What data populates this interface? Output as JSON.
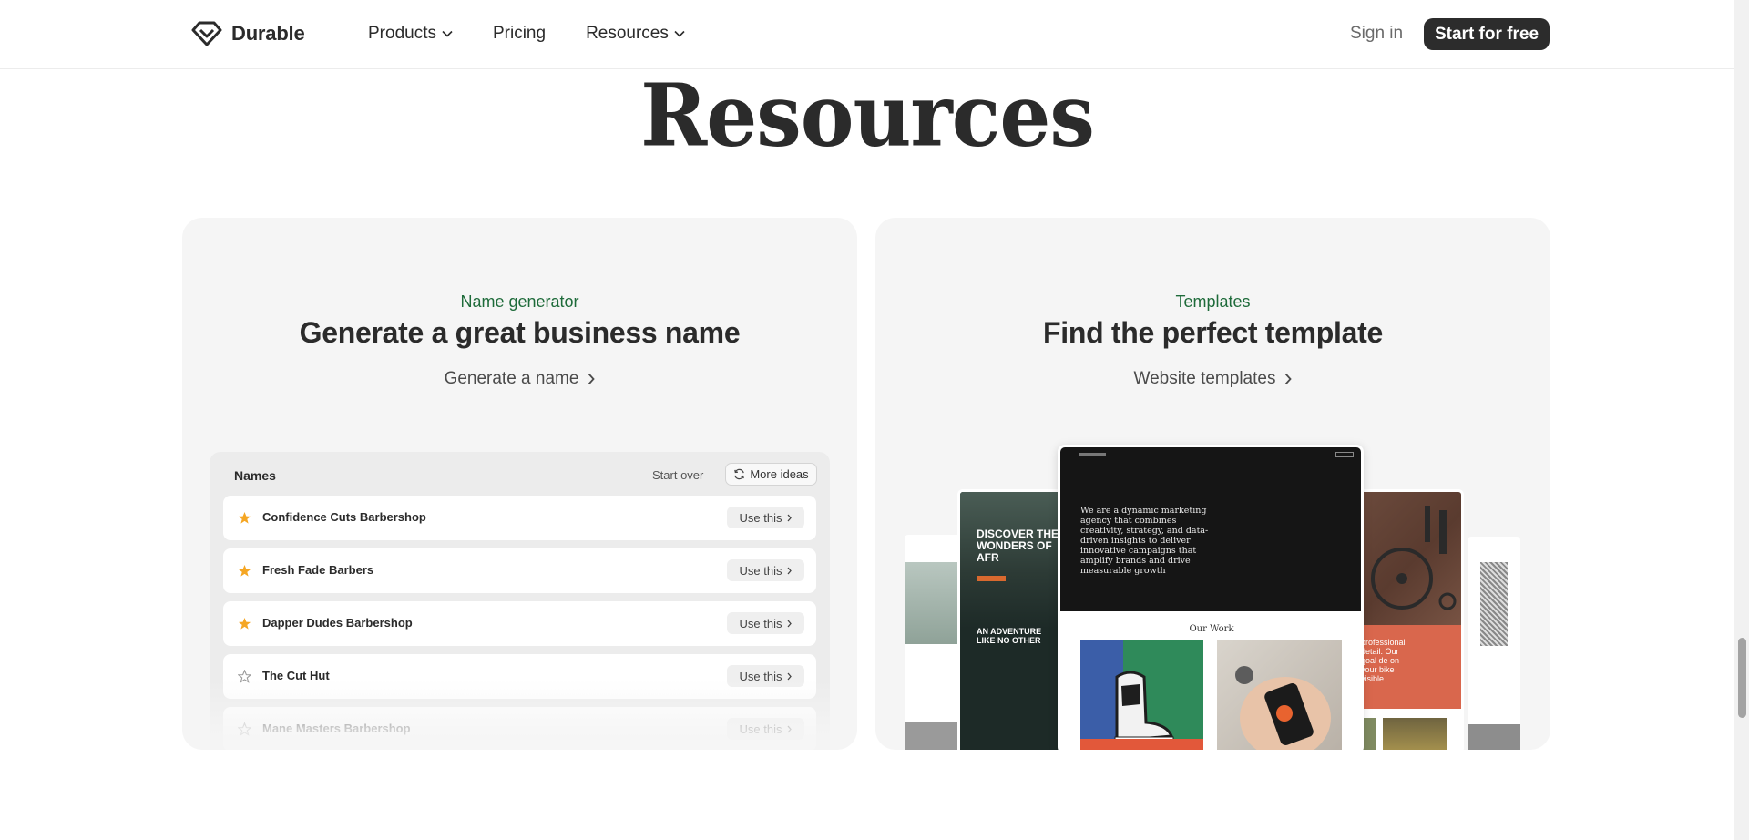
{
  "header": {
    "logo_text": "Durable",
    "nav": [
      {
        "label": "Products",
        "has_dropdown": true
      },
      {
        "label": "Pricing",
        "has_dropdown": false
      },
      {
        "label": "Resources",
        "has_dropdown": true
      }
    ],
    "signin_label": "Sign in",
    "cta_label": "Start for free"
  },
  "page_title": "Resources",
  "cards": {
    "name_generator": {
      "eyebrow": "Name generator",
      "heading": "Generate a great business name",
      "link_label": "Generate a name",
      "panel": {
        "title": "Names",
        "start_over_label": "Start over",
        "more_ideas_label": "More ideas",
        "use_label": "Use this",
        "names": [
          {
            "label": "Confidence Cuts Barbershop",
            "starred": true
          },
          {
            "label": "Fresh Fade Barbers",
            "starred": true
          },
          {
            "label": "Dapper Dudes Barbershop",
            "starred": true
          },
          {
            "label": "The Cut Hut",
            "starred": false
          },
          {
            "label": "Mane Masters Barbershop",
            "starred": false
          }
        ]
      }
    },
    "templates": {
      "eyebrow": "Templates",
      "heading": "Find the perfect template",
      "link_label": "Website templates",
      "previews": {
        "center_tagline": "We are a dynamic marketing agency that combines creativity, strategy, and data-driven insights to deliver innovative campaigns that amplify brands and drive measurable growth",
        "center_section": "Our Work",
        "left_headline": "DISCOVER THE WONDERS OF AFR",
        "left_subhead": "AN ADVENTURE LIKE NO OTHER",
        "right_text": "professional detail. Our goal de on your bike visible."
      }
    }
  },
  "colors": {
    "accent_green": "#1e6b3a",
    "cta_bg": "#2c2c2c",
    "star": "#f5a623",
    "card_bg": "#f5f5f5"
  }
}
